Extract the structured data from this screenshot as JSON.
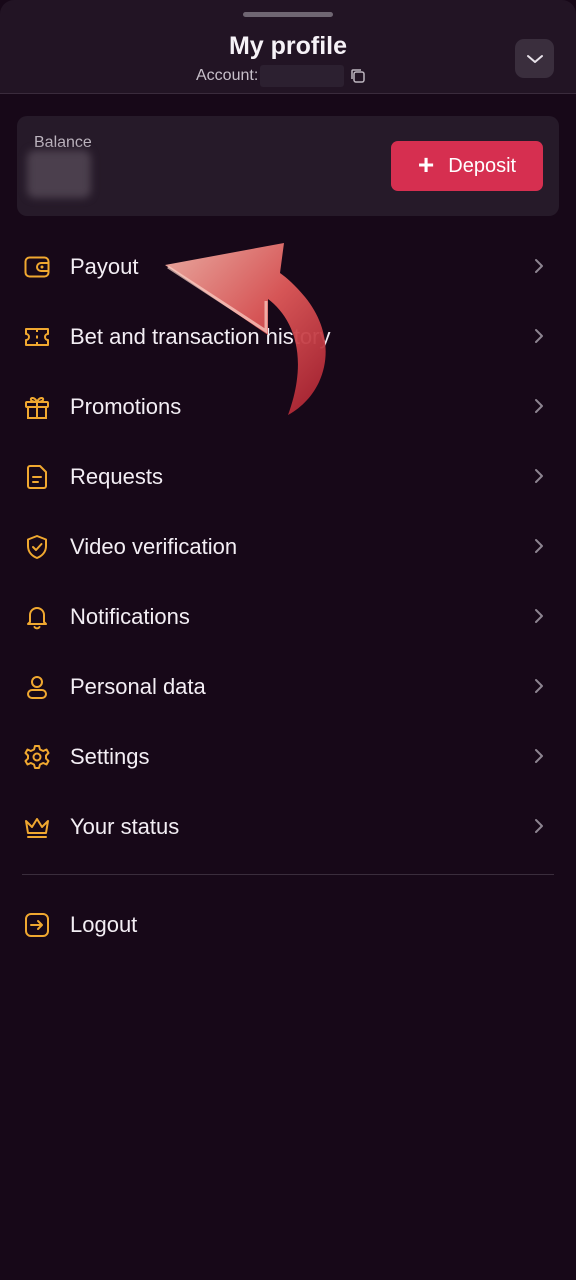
{
  "header": {
    "title": "My profile",
    "account_label": "Account:"
  },
  "balance": {
    "label": "Balance",
    "deposit_label": "Deposit"
  },
  "menu": [
    {
      "label": "Payout",
      "icon": "wallet-icon"
    },
    {
      "label": "Bet and transaction history",
      "icon": "ticket-icon"
    },
    {
      "label": "Promotions",
      "icon": "gift-icon"
    },
    {
      "label": "Requests",
      "icon": "document-icon"
    },
    {
      "label": "Video verification",
      "icon": "shield-check-icon"
    },
    {
      "label": "Notifications",
      "icon": "bell-icon"
    },
    {
      "label": "Personal data",
      "icon": "user-icon"
    },
    {
      "label": "Settings",
      "icon": "gear-icon"
    },
    {
      "label": "Your status",
      "icon": "crown-icon"
    }
  ],
  "logout": {
    "label": "Logout",
    "icon": "logout-icon"
  },
  "colors": {
    "background": "#170818",
    "accent_icon": "#f0a830",
    "deposit_button": "#d62f50",
    "annotation_arrow": "#e05a5a"
  }
}
